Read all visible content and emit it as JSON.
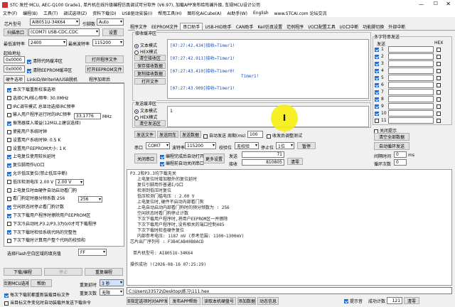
{
  "title": "STC·发控·MCU, AEC-Q100 Grade1, 单片机在线升级编程仿真调试可分软件 (V6.97), 加载APP发布给阵编升级, 车规MCU设计公司",
  "menu": [
    "文件(F)",
    "编程(B)",
    "工具(T)",
    "调试选项(Z)",
    "资料下载(D)",
    "USB驱动安装(I)",
    "帮用工具(H)",
    "图形化AiCube(A)",
    "AI助手(W)",
    "English",
    "www.STCAI.com 论坛交流"
  ],
  "left": {
    "chip_label": "芯片型号",
    "chip_value": "AI8051U-34K64",
    "pin_label": "引脚数",
    "pin_value": "Auto",
    "scan_btn": "扫描串口",
    "port_value": "(COM7) USB-CDC,CDC",
    "settings_btn": "设置",
    "min_baud_label": "最低波特率",
    "min_baud": "2400",
    "max_baud_label": "最高波特率",
    "max_baud": "115200",
    "start_addr_label": "起始地址",
    "addr1": "0x0000",
    "clear_code": "清除代码缓冲区",
    "open_prog_btn": "打开程序文件",
    "addr2": "0x0000",
    "clear_eeprom": "清除EEPROM缓冲区",
    "open_eeprom_btn": "打开EEPROM文件",
    "tabs": [
      "硬件选项",
      "LinkiD/WriterlA/USB脱机",
      "程序加密后"
    ],
    "options": [
      {
        "t": "本次下载重新校准选项",
        "c": true
      },
      {
        "t": "选择CPU核心频率: 30.0MHz",
        "c": false
      },
      {
        "t": "IRC调节模式  总显动选择IRC频率",
        "c": false
      },
      {
        "t": "输入用户程序运行时的IRC频率",
        "c": false
      },
      {
        "t": "振荡器接入增益(12M以上建议选择)",
        "c": true
      },
      {
        "t": "使能用户系统时钟",
        "c": false
      },
      {
        "t": "设置用户系统时钟: 0.5  K",
        "c": false
      },
      {
        "t": "设置用户EEPROM大小: 1  K",
        "c": false
      },
      {
        "t": "上电复位使用较长延时",
        "c": true
      },
      {
        "t": "复位脚用作I/O口",
        "c": true
      },
      {
        "t": "允许低压复位(禁止低压中断)",
        "c": true
      },
      {
        "t": "低压检测电压  2.00 V",
        "c": false
      },
      {
        "t": "上电复位时由硬件自动启动看门狗",
        "c": false
      },
      {
        "t": "看门狗定时器分频系数  256",
        "c": false
      },
      {
        "t": "空闲状态时停止看门狗计数",
        "c": true
      },
      {
        "t": "下次下载用户程序时擦除用户EEPROM区",
        "c": true
      },
      {
        "t": "下次冷启动时,P3.2/P3.3为0/0才可下载程序",
        "c": false
      },
      {
        "t": "下次下载时检验系统代码的完整性",
        "c": true
      },
      {
        "t": "下次下载时计算用户整个代码的校验和",
        "c": false
      }
    ],
    "irc_freq": "33.1776",
    "mhz": "MHz",
    "lvd": "2.00 V",
    "wdt": "256",
    "lvr_label": "低压检测电压",
    "flash_label": "选择Flash空白区域的填充值",
    "flash_val": "FF",
    "download_btn": "下载/编程",
    "stop_btn": "停止",
    "reprog_btn": "重复编程",
    "detect_btn": "检测MCU选项",
    "help_btn": "帮助",
    "repeat_delay": "重复延时",
    "delay_val": "3 秒",
    "repeat_count": "重复次数",
    "count_val": "无限",
    "reload_cb": "每次下载前都重新装载目标文件",
    "auto_cb": "当目标文件变化时自动装载并发送下载命令"
  },
  "toolbar": [
    "程序文件",
    "EEPROM文件",
    "串口助手",
    "USB-HID助手",
    "CAN助手",
    "Keil仿真设置",
    "范例程序",
    "I/O口配置工具",
    "I/O口中断",
    "功能脚切换",
    "外部中断"
  ],
  "serial": {
    "recv_title": "接收缓冲区",
    "text_mode": "文本模式",
    "hex_mode": "HEX模式",
    "clear_recv": "清空接收区",
    "save_recv": "保存接收数据",
    "copy_recv": "复制接收数据",
    "open_file": "打开文件",
    "recv_lines": [
      "[07:27:42.434]接收←Timer1!",
      "[07:27:42.911]接收←Timer1!",
      "[07:27:43.410]接收←Timer0!",
      "Timer1!",
      "[07:27:43.909]接收←Timer1!"
    ],
    "send_title": "发送缓冲区",
    "send_text_mode": "文本模式",
    "send_hex_mode": "HEX模式",
    "clear_send": "清空发送区",
    "send_content": "1",
    "send_file": "发送文件",
    "send_back": "发送回车",
    "send_data": "发送数据",
    "auto_send": "自动发送",
    "period_label": "周期(ms)",
    "period": "100",
    "toggle_send": "收发后调整测试",
    "port_label": "串口",
    "port": "COM7",
    "baud_label": "波特率",
    "baud": "115200",
    "check_label": "校验位",
    "check": "无校验",
    "stop_label": "停止位",
    "stop": "1位",
    "pause_btn": "暂停",
    "close_btn": "关闭串口",
    "auto_open": "编程完成后自动打开串口",
    "auto_close": "编程前自动关闭串口",
    "more_btn": "更多设置",
    "sent_label": "发送",
    "sent": "71",
    "recv_label": "接收",
    "recv": "810805",
    "clear_btn": "清零"
  },
  "multi": {
    "title": "多字符串发送",
    "send_col": "发送",
    "hex_col": "HEX",
    "rows": [
      "1",
      "2",
      "3",
      "4",
      "5",
      "6",
      "7",
      "8",
      "9",
      "10",
      "11"
    ],
    "close_tip": "关闭提示",
    "clear_all": "清空全部数据",
    "auto_loop": "自动循环发送",
    "interval_label": "间隔时间",
    "interval": "0",
    "interval_unit": "ms",
    "loop_label": "循环次数",
    "loop": "0"
  },
  "log": {
    "lines": [
      "P3.2和P3.3均下载无关",
      "上电复位时增加额外的复位延时",
      "复位引脚用作普通I/O口",
      "检测到低压时复位",
      "低压检测门槛电压 : 2.00 V",
      "上电复位时,硬件不启动内部看门狗",
      "上电自动启动内部看门狗时的预分频数为 : 256",
      "空闲状态时看门狗停止计数",
      "下次下载用户程序时,将用户EEPROM区一并擦除",
      "下次下载用户程序时,没有相关的端口控制485",
      "下次下载时检查硬件复位",
      "内部参考电压: 1187 mV (参考范围: 1100~1300mV)"
    ],
    "chip_tag": "芯片出厂序列号 :",
    "serial_num": "F3B4CAB40B8ACD",
    "model_line": "单片机型号: AI8051U-34K64",
    "success": "操作成功 !(2026-08-16 07:25:29)",
    "path": "C:\\Users\\33572\\Desktop\\练习\\111.hex"
  },
  "status": {
    "items": [
      "选择指定选项时对APP发布",
      "发布APP帮助",
      "读取本机硬盘号",
      "添加数据",
      "动态信息"
    ],
    "tip_cb": "提示音",
    "count": "121",
    "clear_btn": "清零",
    "bottom_cb": "成功计数"
  }
}
